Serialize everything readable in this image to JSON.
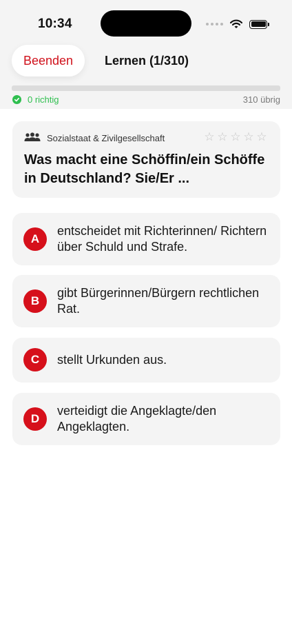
{
  "status_bar": {
    "time": "10:34"
  },
  "header": {
    "end_label": "Beenden",
    "title": "Lernen (1/310)",
    "progress_fraction": 0.0,
    "correct_text": "0 richtig",
    "remaining_text": "310 übrig"
  },
  "question": {
    "category": "Sozialstaat & Zivilgesellschaft",
    "category_icon": "people-group-icon",
    "text": "Was macht eine Schöffin/ein Schöffe in Deutschland? Sie/Er ...",
    "rating_max": 5,
    "rating_value": 0
  },
  "answers": [
    {
      "letter": "A",
      "text": "entscheidet mit Richterinnen/ Richtern über Schuld und Strafe."
    },
    {
      "letter": "B",
      "text": "gibt Bürgerinnen/Bürgern rechtlichen Rat."
    },
    {
      "letter": "C",
      "text": "stellt Urkunden aus."
    },
    {
      "letter": "D",
      "text": "verteidigt die Angeklagte/den Angeklagten."
    }
  ],
  "colors": {
    "accent_red": "#d6101b",
    "success_green": "#2fbf4f",
    "card_bg": "#f4f4f4"
  }
}
